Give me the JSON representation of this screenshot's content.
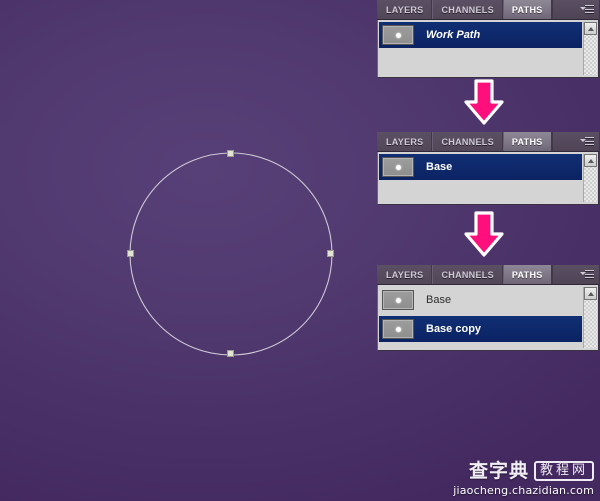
{
  "app": {
    "background_color": "#4a3168",
    "accent_color": "#ff0f7b",
    "panel_body_color": "#d4d4d4",
    "selection_color": "#0d2a6b"
  },
  "artboard": {
    "path_name": "circle-path",
    "anchor_count": 4,
    "path_stroke_color": "#cfc9d6"
  },
  "panels": [
    {
      "id": "paths-panel-1",
      "tabs": [
        {
          "label": "LAYERS",
          "active": false
        },
        {
          "label": "CHANNELS",
          "active": false
        },
        {
          "label": "PATHS",
          "active": true
        }
      ],
      "menu_icon": "panel-menu-icon",
      "scrollbar": {
        "up_button": "scroll-up-button"
      },
      "rows": [
        {
          "label": "Work Path",
          "selected": true,
          "italic": true,
          "thumbnail": "path-thumbnail"
        }
      ]
    },
    {
      "id": "paths-panel-2",
      "tabs": [
        {
          "label": "LAYERS",
          "active": false
        },
        {
          "label": "CHANNELS",
          "active": false
        },
        {
          "label": "PATHS",
          "active": true
        }
      ],
      "menu_icon": "panel-menu-icon",
      "scrollbar": {
        "up_button": "scroll-up-button"
      },
      "rows": [
        {
          "label": "Base",
          "selected": true,
          "italic": false,
          "thumbnail": "path-thumbnail"
        }
      ]
    },
    {
      "id": "paths-panel-3",
      "tabs": [
        {
          "label": "LAYERS",
          "active": false
        },
        {
          "label": "CHANNELS",
          "active": false
        },
        {
          "label": "PATHS",
          "active": true
        }
      ],
      "menu_icon": "panel-menu-icon",
      "scrollbar": {
        "up_button": "scroll-up-button"
      },
      "rows": [
        {
          "label": "Base",
          "selected": false,
          "italic": false,
          "thumbnail": "path-thumbnail"
        },
        {
          "label": "Base copy",
          "selected": true,
          "italic": false,
          "thumbnail": "path-thumbnail"
        }
      ]
    }
  ],
  "arrows": [
    {
      "name": "down-arrow-1",
      "direction": "down",
      "fill": "#ff0f7b",
      "stroke": "#ffffff"
    },
    {
      "name": "down-arrow-2",
      "direction": "down",
      "fill": "#ff0f7b",
      "stroke": "#ffffff"
    }
  ],
  "watermark": {
    "brand": "查字典",
    "badge": "教程网",
    "url": "jiaocheng.chazidian.com"
  }
}
